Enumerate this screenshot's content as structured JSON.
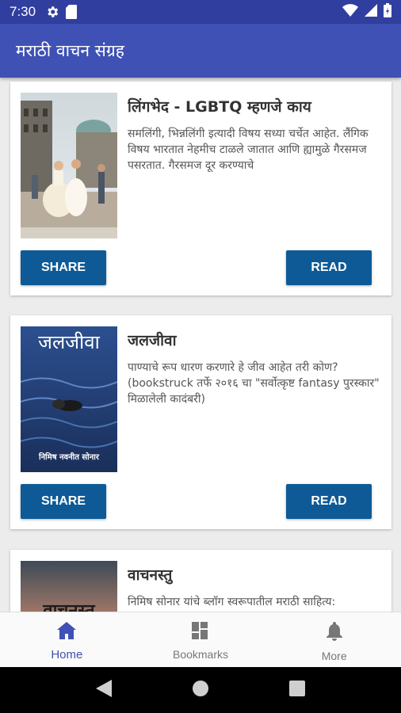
{
  "status": {
    "time": "7:30"
  },
  "app": {
    "title": "मराठी वाचन संग्रह"
  },
  "books": [
    {
      "title": "लिंगभेद - LGBTQ म्हणजे काय",
      "description": "समलिंगी, भिन्नलिंगी इत्यादी विषय सध्या चर्चेत आहेत. लैंगिक विषय भारतात नेहमीच टाळले जातात आणि ह्यामुळे गैरसमज पसरतात. गैरसमज दूर करण्याचे",
      "share_label": "SHARE",
      "read_label": "READ"
    },
    {
      "title": "जलजीवा",
      "cover_title": "जलजीवा",
      "cover_author": "निमिष नवनीत सोनार",
      "description": "पाण्याचे रूप धारण करणारे हे जीव आहेत तरी कोण? (bookstruck तर्फे २०१६ चा \"सर्वोत्कृष्ट fantasy पुरस्कार\" मिळालेली कादंबरी)",
      "share_label": "SHARE",
      "read_label": "READ"
    },
    {
      "title": "वाचनस्तु",
      "description": "निमिष सोनार यांचे ब्लॉग स्वरूपातील मराठी साहित्य:",
      "cover_text": "वाचनस्तु"
    }
  ],
  "bottom_nav": [
    {
      "label": "Home",
      "icon": "home-icon",
      "active": true
    },
    {
      "label": "Bookmarks",
      "icon": "dashboard-icon",
      "active": false
    },
    {
      "label": "More",
      "icon": "bell-icon",
      "active": false
    }
  ],
  "colors": {
    "status_bar": "#303f9f",
    "app_bar": "#3f51b5",
    "button": "#0d5a96",
    "active_nav": "#3f51b5"
  }
}
